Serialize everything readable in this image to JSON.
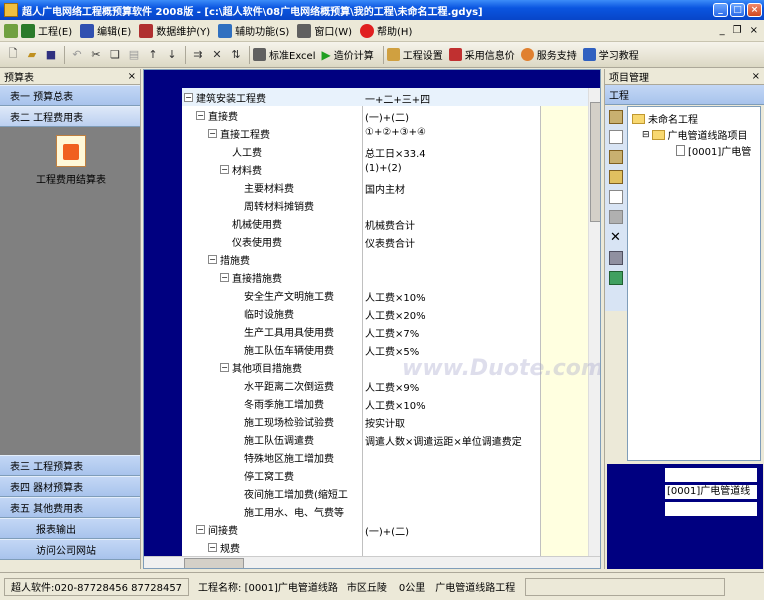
{
  "window": {
    "title": "超人广电网络工程概预算软件 2008版 - [c:\\超人软件\\08广电网络概预算\\我的工程\\未命名工程.gdys]"
  },
  "menu": [
    {
      "label": "工程(E)",
      "icon": "project-icon",
      "color": "#2a7a2a"
    },
    {
      "label": "编辑(E)",
      "icon": "edit-icon",
      "color": "#3050b0"
    },
    {
      "label": "数据维护(Y)",
      "icon": "database-icon",
      "color": "#b03030"
    },
    {
      "label": "辅助功能(S)",
      "icon": "tools-icon",
      "color": "#3070c0"
    },
    {
      "label": "窗口(W)",
      "icon": "window-icon",
      "color": "#606060"
    },
    {
      "label": "帮助(H)",
      "icon": "help-icon",
      "color": "#e02020"
    }
  ],
  "toolbar": {
    "excel": "标准Excel",
    "calc": "造价计算",
    "settings": "工程设置",
    "price": "采用信息价",
    "support": "服务支持",
    "tutorial": "学习教程"
  },
  "left": {
    "title": "预算表",
    "tabs_top": [
      "表一 预算总表",
      "表二 工程费用表"
    ],
    "report_item": "工程费用结算表",
    "tabs_bottom": [
      "表三 工程预算表",
      "表四 器材预算表",
      "表五 其他费用表"
    ],
    "links": [
      "报表输出",
      "访问公司网站"
    ]
  },
  "grid": {
    "rows": [
      {
        "name": "建筑安装工程费",
        "formula": "一+二+三+四",
        "level": 0,
        "exp": true
      },
      {
        "name": "直接费",
        "formula": "(一)+(二)",
        "level": 1,
        "exp": true
      },
      {
        "name": "直接工程费",
        "formula": "①+②+③+④",
        "level": 2,
        "exp": true
      },
      {
        "name": "人工费",
        "formula": "总工日×33.4",
        "level": 3,
        "exp": false
      },
      {
        "name": "材料费",
        "formula": "(1)+(2)",
        "level": 3,
        "exp": true
      },
      {
        "name": "主要材料费",
        "formula": "国内主材",
        "level": 4,
        "exp": false
      },
      {
        "name": "周转材料摊销费",
        "formula": "",
        "level": 4,
        "exp": false
      },
      {
        "name": "机械使用费",
        "formula": "机械费合计",
        "level": 3,
        "exp": false
      },
      {
        "name": "仪表使用费",
        "formula": "仪表费合计",
        "level": 3,
        "exp": false
      },
      {
        "name": "措施费",
        "formula": "",
        "level": 2,
        "exp": true
      },
      {
        "name": "直接措施费",
        "formula": "",
        "level": 3,
        "exp": true
      },
      {
        "name": "安全生产文明施工费",
        "formula": "人工费×10%",
        "level": 4,
        "exp": false
      },
      {
        "name": "临时设施费",
        "formula": "人工费×20%",
        "level": 4,
        "exp": false
      },
      {
        "name": "生产工具用具使用费",
        "formula": "人工费×7%",
        "level": 4,
        "exp": false
      },
      {
        "name": "施工队伍车辆使用费",
        "formula": "人工费×5%",
        "level": 4,
        "exp": false
      },
      {
        "name": "其他项目措施费",
        "formula": "",
        "level": 3,
        "exp": true
      },
      {
        "name": "水平距离二次倒运费",
        "formula": "人工费×9%",
        "level": 4,
        "exp": false
      },
      {
        "name": "冬雨季施工增加费",
        "formula": "人工费×10%",
        "level": 4,
        "exp": false
      },
      {
        "name": "施工现场检验试验费",
        "formula": "按实计取",
        "level": 4,
        "exp": false
      },
      {
        "name": "施工队伍调遣费",
        "formula": "调遣人数×调遣运距×单位调遣费定",
        "level": 4,
        "exp": false
      },
      {
        "name": "特殊地区施工增加费",
        "formula": "",
        "level": 4,
        "exp": false
      },
      {
        "name": "停工窝工费",
        "formula": "",
        "level": 4,
        "exp": false
      },
      {
        "name": "夜间施工增加费(缩短工",
        "formula": "",
        "level": 4,
        "exp": false
      },
      {
        "name": "施工用水、电、气费等",
        "formula": "",
        "level": 4,
        "exp": false
      },
      {
        "name": "间接费",
        "formula": "(一)+(二)",
        "level": 1,
        "exp": true
      },
      {
        "name": "规费",
        "formula": "",
        "level": 2,
        "exp": true
      }
    ]
  },
  "right": {
    "title": "项目管理",
    "tab": "工程",
    "tree": [
      "未命名工程",
      "广电管道线路项目",
      "[0001]广电管"
    ],
    "field_value": "[0001]广电管道线"
  },
  "status": {
    "company": "超人软件:020-87728456 87728457",
    "project": "工程名称: [0001]广电管道线路",
    "terrain": "市区丘陵",
    "distance": "0公里",
    "type": "广电管道线路工程"
  },
  "watermark": "www.Duote.com"
}
